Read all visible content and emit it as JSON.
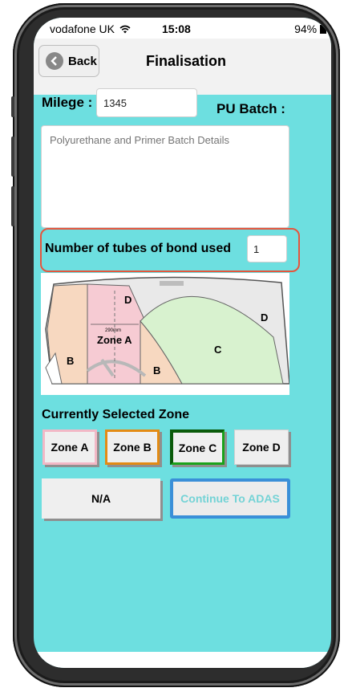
{
  "status_bar": {
    "carrier": "vodafone UK",
    "time": "15:08",
    "battery": "94%"
  },
  "nav": {
    "back_label": "Back",
    "title": "Finalisation"
  },
  "form": {
    "mileage_label": "Milege :",
    "mileage_value": "1345",
    "pu_batch_label": "PU Batch :",
    "batch_placeholder": "Polyurethane and Primer Batch Details",
    "tubes_label": "Number of tubes of bond used",
    "tubes_value": "1"
  },
  "diagram": {
    "label_D_top": "D",
    "label_D_right": "D",
    "label_C": "C",
    "label_B_left": "B",
    "label_B_right": "B",
    "label_zone_a": "Zone A",
    "label_dimension": "290mm"
  },
  "zones": {
    "heading": "Currently Selected Zone",
    "buttons": [
      {
        "label": "Zone A",
        "border": "#f2b8c6"
      },
      {
        "label": "Zone B",
        "border": "#e38b14"
      },
      {
        "label": "Zone C",
        "border": "#1aa21a"
      },
      {
        "label": "Zone D",
        "border": "#d0d0d0"
      }
    ]
  },
  "actions": {
    "na_label": "N/A",
    "continue_label": "Continue To ADAS"
  },
  "colors": {
    "screen_bg": "#6ddfe0",
    "highlight": "#e5553d",
    "continue_text": "#74d3d6",
    "continue_border": "#3a8fd8"
  }
}
